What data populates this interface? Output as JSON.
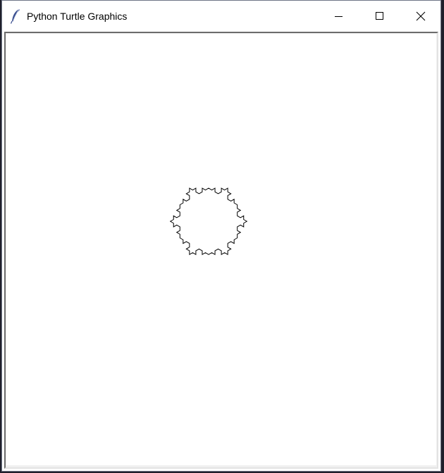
{
  "window": {
    "title": "Python Turtle Graphics",
    "app_icon": "feather-icon"
  },
  "controls": {
    "minimize_icon": "minimize-icon",
    "maximize_icon": "maximize-icon",
    "close_icon": "close-icon"
  },
  "drawing": {
    "shape": "koch-snowflake-inverted",
    "stroke_color": "#000000",
    "background_color": "#ffffff"
  }
}
